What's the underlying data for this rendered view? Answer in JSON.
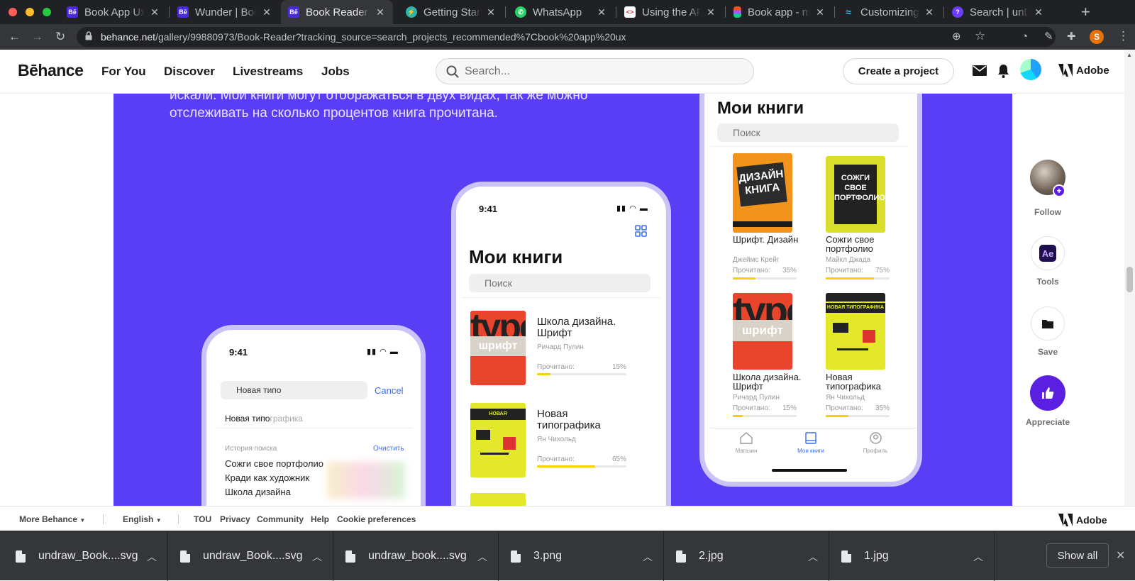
{
  "browser": {
    "tabs": [
      {
        "title": "Book App Ux",
        "favicon": "behance",
        "active": false
      },
      {
        "title": "Wunder | Boo",
        "favicon": "behance",
        "active": false
      },
      {
        "title": "Book Reader (",
        "favicon": "behance",
        "active": true
      },
      {
        "title": "Getting Starte",
        "favicon": "bolt",
        "active": false
      },
      {
        "title": "WhatsApp",
        "favicon": "whatsapp",
        "active": false
      },
      {
        "title": "Using the API",
        "favicon": "code",
        "active": false
      },
      {
        "title": "Book app - m",
        "favicon": "figma",
        "active": false
      },
      {
        "title": "Customizing C",
        "favicon": "wave",
        "active": false
      },
      {
        "title": "Search | unDr",
        "favicon": "undraw",
        "active": false
      }
    ],
    "url_domain": "behance.net",
    "url_path": "/gallery/99880973/Book-Reader?tracking_source=search_projects_recommended%7Cbook%20app%20ux",
    "profile_initial": "S"
  },
  "behance": {
    "logo": "Bēhance",
    "nav": [
      "For You",
      "Discover",
      "Livestreams",
      "Jobs"
    ],
    "search_placeholder": "Search...",
    "create_label": "Create a project",
    "adobe_label": "Adobe"
  },
  "project": {
    "description": "искали. Мои книги могут отображаться в двух видах, так же можно отслеживать на сколько процентов книга прочитана.",
    "phone_search": {
      "time": "9:41",
      "query": "Новая типо",
      "cancel": "Cancel",
      "suggestion_typed": "Новая типо",
      "suggestion_rest": "графика",
      "history_title": "История поиска",
      "clear": "Очистить",
      "history": [
        "Сожги свое портфолио",
        "Кради как художник",
        "Школа дизайна"
      ]
    },
    "phone_list": {
      "time": "9:41",
      "heading": "Мои книги",
      "search": "Поиск",
      "books": [
        {
          "title": "Школа дизайна. Шрифт",
          "author": "Ричард Пулин",
          "read_label": "Прочитано:",
          "percent": "15%",
          "progress": 0.15
        },
        {
          "title": "Новая типографика",
          "author": "Ян Чихольд",
          "read_label": "Прочитано:",
          "percent": "65%",
          "progress": 0.65
        }
      ]
    },
    "phone_grid": {
      "heading": "Мои книги",
      "search": "Поиск",
      "books": [
        {
          "title": "Шрифт. Дизайн",
          "author": "Джеймс Крейг",
          "read_label": "Прочитано:",
          "percent": "35%",
          "progress": 0.35
        },
        {
          "title": "Сожги свое портфолио",
          "author": "Майкл Джада",
          "read_label": "Прочитано:",
          "percent": "75%",
          "progress": 0.75
        },
        {
          "title": "Школа дизайна. Шрифт",
          "author": "Ричард Пулин",
          "read_label": "Прочитано:",
          "percent": "15%",
          "progress": 0.15
        },
        {
          "title": "Новая типографика",
          "author": "Ян Чихольд",
          "read_label": "Прочитано:",
          "percent": "35%",
          "progress": 0.35
        }
      ],
      "tabs": [
        "Магазин",
        "Мои книги",
        "Профиль"
      ],
      "cover_text": {
        "shrift_design": "ДИЗАЙН КНИГА",
        "sozhgi": "СОЖГИ СВОЕ ПОРТФОЛИО!",
        "type": "type",
        "shrift": "шрифт",
        "novaya": "НОВАЯ ТИПОГРАФИКА"
      }
    }
  },
  "rail": {
    "follow": "Follow",
    "tools": "Tools",
    "tools_badge": "Ae",
    "save": "Save",
    "appreciate": "Appreciate"
  },
  "footer": {
    "more": "More Behance",
    "language": "English",
    "links": [
      "TOU",
      "Privacy",
      "Community",
      "Help",
      "Cookie preferences"
    ],
    "adobe": "Adobe"
  },
  "downloads": {
    "files": [
      "undraw_Book....svg",
      "undraw_Book....svg",
      "undraw_book....svg",
      "3.png",
      "2.jpg",
      "1.jpg"
    ],
    "show_all": "Show all"
  },
  "colors": {
    "hero": "#5a3ef5",
    "accent": "#5a1fe0",
    "progress": "#f6d100"
  }
}
